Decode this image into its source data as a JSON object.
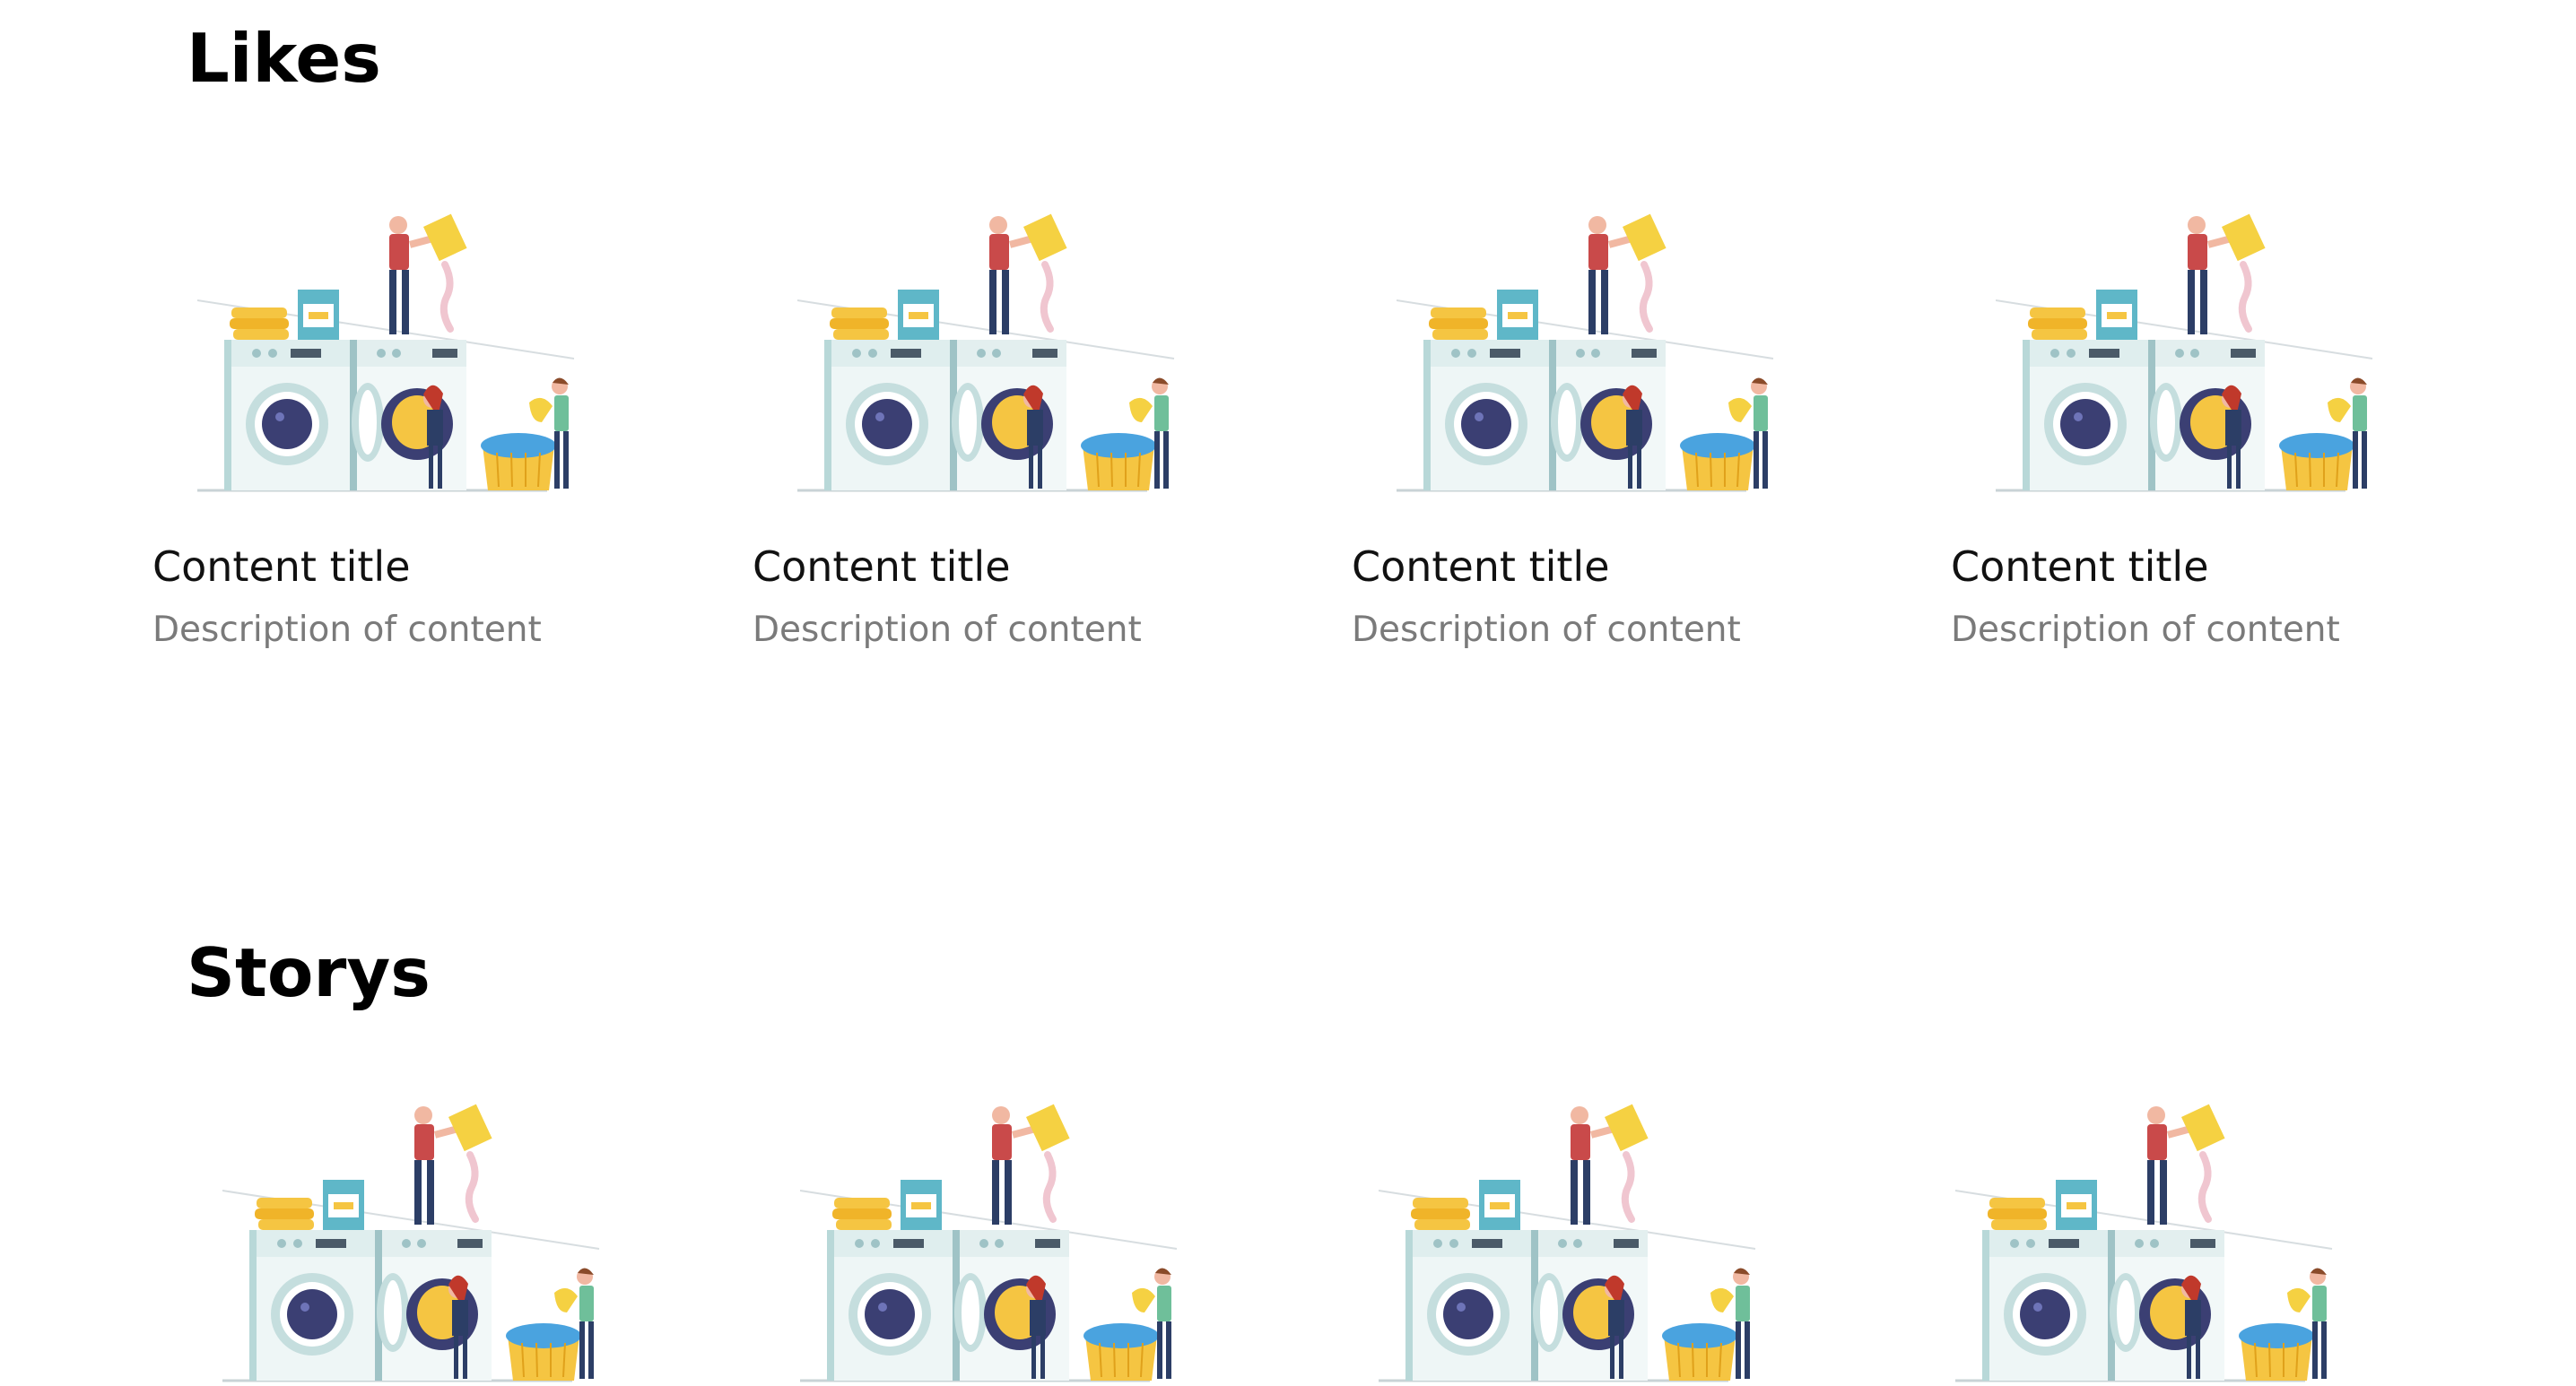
{
  "sections": [
    {
      "title": "Likes",
      "cards": [
        {
          "title": "Content title",
          "description": "Description of content",
          "image": "laundry-illustration"
        },
        {
          "title": "Content title",
          "description": "Description of content",
          "image": "laundry-illustration"
        },
        {
          "title": "Content title",
          "description": "Description of content",
          "image": "laundry-illustration"
        },
        {
          "title": "Content title",
          "description": "Description of content",
          "image": "laundry-illustration"
        }
      ]
    },
    {
      "title": "Storys",
      "cards": [
        {
          "image": "laundry-illustration"
        },
        {
          "image": "laundry-illustration"
        },
        {
          "image": "laundry-illustration"
        },
        {
          "image": "laundry-illustration"
        }
      ]
    }
  ]
}
